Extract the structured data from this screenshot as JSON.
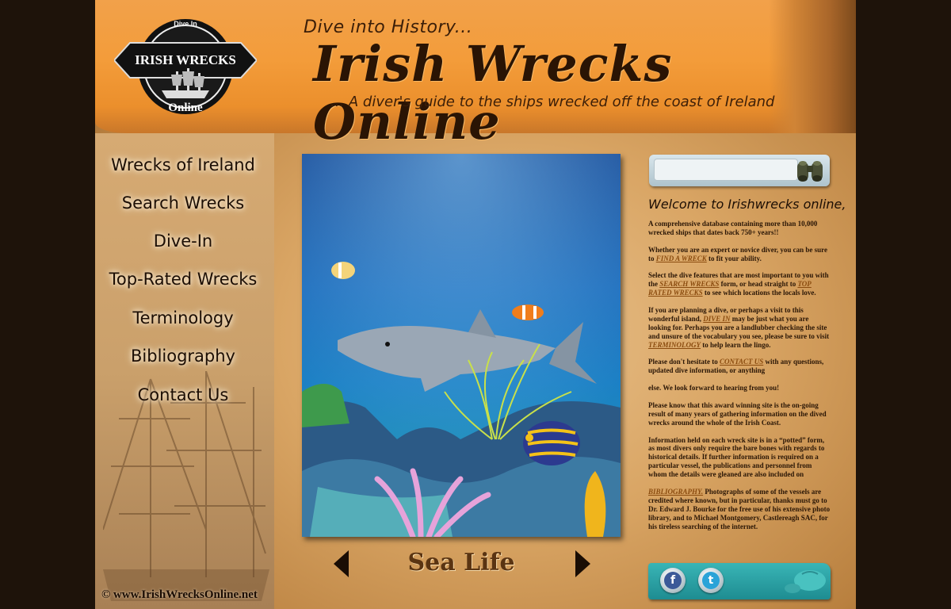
{
  "header": {
    "logo_text_top": "Dive In",
    "logo_text_middle": "IRISH WRECKS",
    "logo_text_bottom": "Online",
    "tagline_top": "Dive into History...",
    "title": "Irish Wrecks Online",
    "tagline_bottom": "... A diver's guide to the ships wrecked off the coast of Ireland"
  },
  "nav": {
    "items": [
      {
        "label": "Wrecks of Ireland"
      },
      {
        "label": "Search Wrecks"
      },
      {
        "label": "Dive-In"
      },
      {
        "label": "Top-Rated Wrecks"
      },
      {
        "label": "Terminology"
      },
      {
        "label": "Bibliography"
      },
      {
        "label": "Contact Us"
      }
    ]
  },
  "copyright": "© www.IrishWrecksOnline.net",
  "slideshow": {
    "caption": "Sea Life",
    "prev_icon": "arrow-left-icon",
    "next_icon": "arrow-right-icon"
  },
  "search": {
    "placeholder": "",
    "icon": "binoculars-icon"
  },
  "welcome": {
    "title": "Welcome to Irishwrecks online,",
    "p1": "A comprehensive database containing more than 10,000 wrecked ships that dates back 750+ years!!",
    "p2_before": "Whether you are an expert or novice diver, you can be sure to ",
    "p2_link": "FIND A WRECK",
    "p2_after": " to fit your ability.",
    "p3_before": "Select the dive features that are most important to you with the ",
    "p3_link1": "SEARCH WRECKS",
    "p3_mid": " form, or head straight to ",
    "p3_link2": "TOP RATED WRECKS",
    "p3_after": " to see which locations the locals love.",
    "p4_before": "If you are planning a dive, or perhaps a visit to this wonderful island, ",
    "p4_link1": "DIVE IN",
    "p4_mid": " may be just what you are looking for. Perhaps you are a landlubber checking the site and unsure of the vocabulary you see, please be sure to visit ",
    "p4_link2": "TERMINOLOGY",
    "p4_after": " to help learn the lingo.",
    "p5_before": "Please don't hesitate to ",
    "p5_link": "CONTACT US",
    "p5_after": " with any questions, updated dive information, or anything",
    "p6": "else. We look forward to hearing from you!",
    "p7": "Please know that this award winning site is the on-going result of many years of gathering information on the dived wrecks around the whole of the Irish Coast.",
    "p8": "Information held on each wreck site is in a “potted” form, as most divers only require the bare bones with regards to historical details.  If further information is required on a particular vessel, the publications and personnel from whom the details were gleaned are also included on",
    "p9_link": "BIBLIOGRAPHY.",
    "p9_after": "  Photographs of some of the vessels are credited where known, but in particular, thanks must go to Dr. Edward J. Bourke for the free use of his extensive photo library, and to Michael Montgomery, Castlereagh SAC, for his tireless searching of the internet."
  },
  "social": {
    "facebook_glyph": "f",
    "twitter_glyph": "t"
  },
  "colors": {
    "banner": "#f39c3a",
    "parchment": "#d9a564",
    "link": "#8a4b0e",
    "social_bar": "#1e8c91"
  }
}
